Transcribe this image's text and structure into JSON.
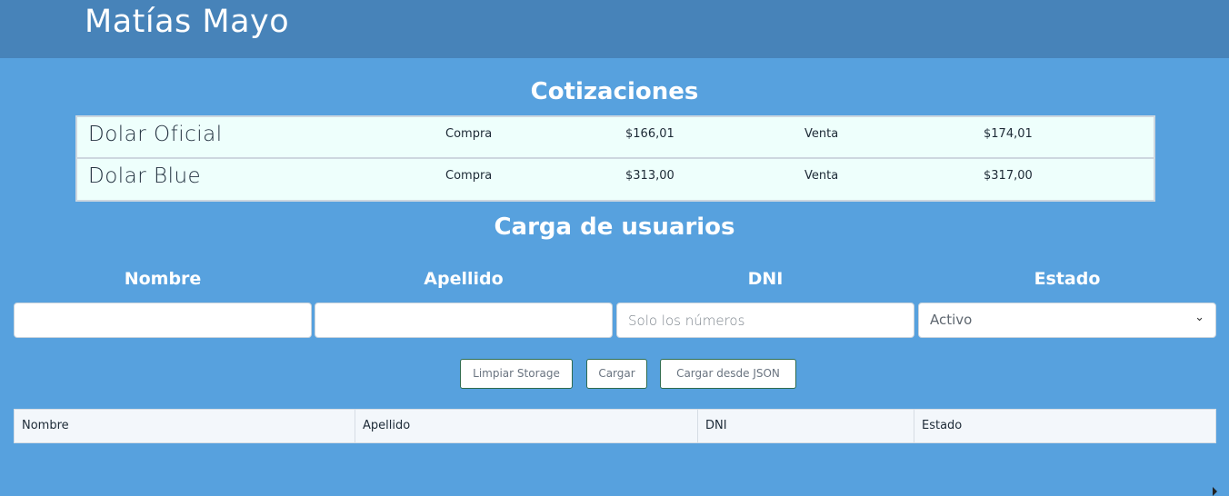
{
  "header": {
    "title": "Matías Mayo"
  },
  "quotes": {
    "title": "Cotizaciones",
    "rows": [
      {
        "name": "Dolar Oficial",
        "buy_label": "Compra",
        "buy_value": "$166,01",
        "sell_label": "Venta",
        "sell_value": "$174,01"
      },
      {
        "name": "Dolar Blue",
        "buy_label": "Compra",
        "buy_value": "$313,00",
        "sell_label": "Venta",
        "sell_value": "$317,00"
      }
    ]
  },
  "form": {
    "title": "Carga de usuarios",
    "fields": {
      "nombre": {
        "label": "Nombre",
        "value": "",
        "placeholder": ""
      },
      "apellido": {
        "label": "Apellido",
        "value": "",
        "placeholder": ""
      },
      "dni": {
        "label": "DNI",
        "value": "",
        "placeholder": "Solo los números"
      },
      "estado": {
        "label": "Estado",
        "selected": "Activo"
      }
    },
    "buttons": {
      "clear": "Limpiar Storage",
      "load": "Cargar",
      "load_json": "Cargar desde JSON"
    }
  },
  "table": {
    "headers": [
      "Nombre",
      "Apellido",
      "DNI",
      "Estado"
    ]
  }
}
